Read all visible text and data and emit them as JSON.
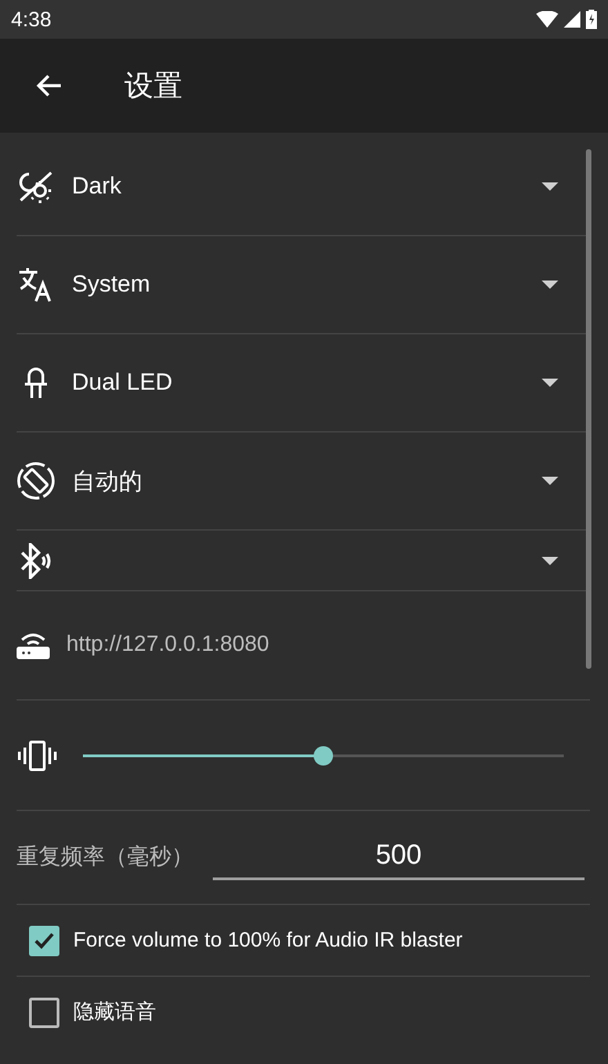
{
  "status_bar": {
    "time": "4:38"
  },
  "app_bar": {
    "title": "设置"
  },
  "settings": [
    {
      "kind": "dropdown",
      "value": "Dark"
    },
    {
      "kind": "dropdown",
      "value": "System"
    },
    {
      "kind": "dropdown",
      "value": "Dual LED"
    },
    {
      "kind": "dropdown",
      "value": "自动的"
    },
    {
      "kind": "dropdown"
    },
    {
      "kind": "text",
      "value": "http://127.0.0.1:8080"
    },
    {
      "kind": "slider",
      "level": 0.5
    },
    {
      "kind": "input",
      "label": "重复频率（毫秒）",
      "value": "500"
    },
    {
      "kind": "checkbox",
      "label": "Force volume to 100% for Audio IR blaster",
      "checked": true
    },
    {
      "kind": "checkbox",
      "label": "隐藏语音",
      "checked": false
    }
  ]
}
